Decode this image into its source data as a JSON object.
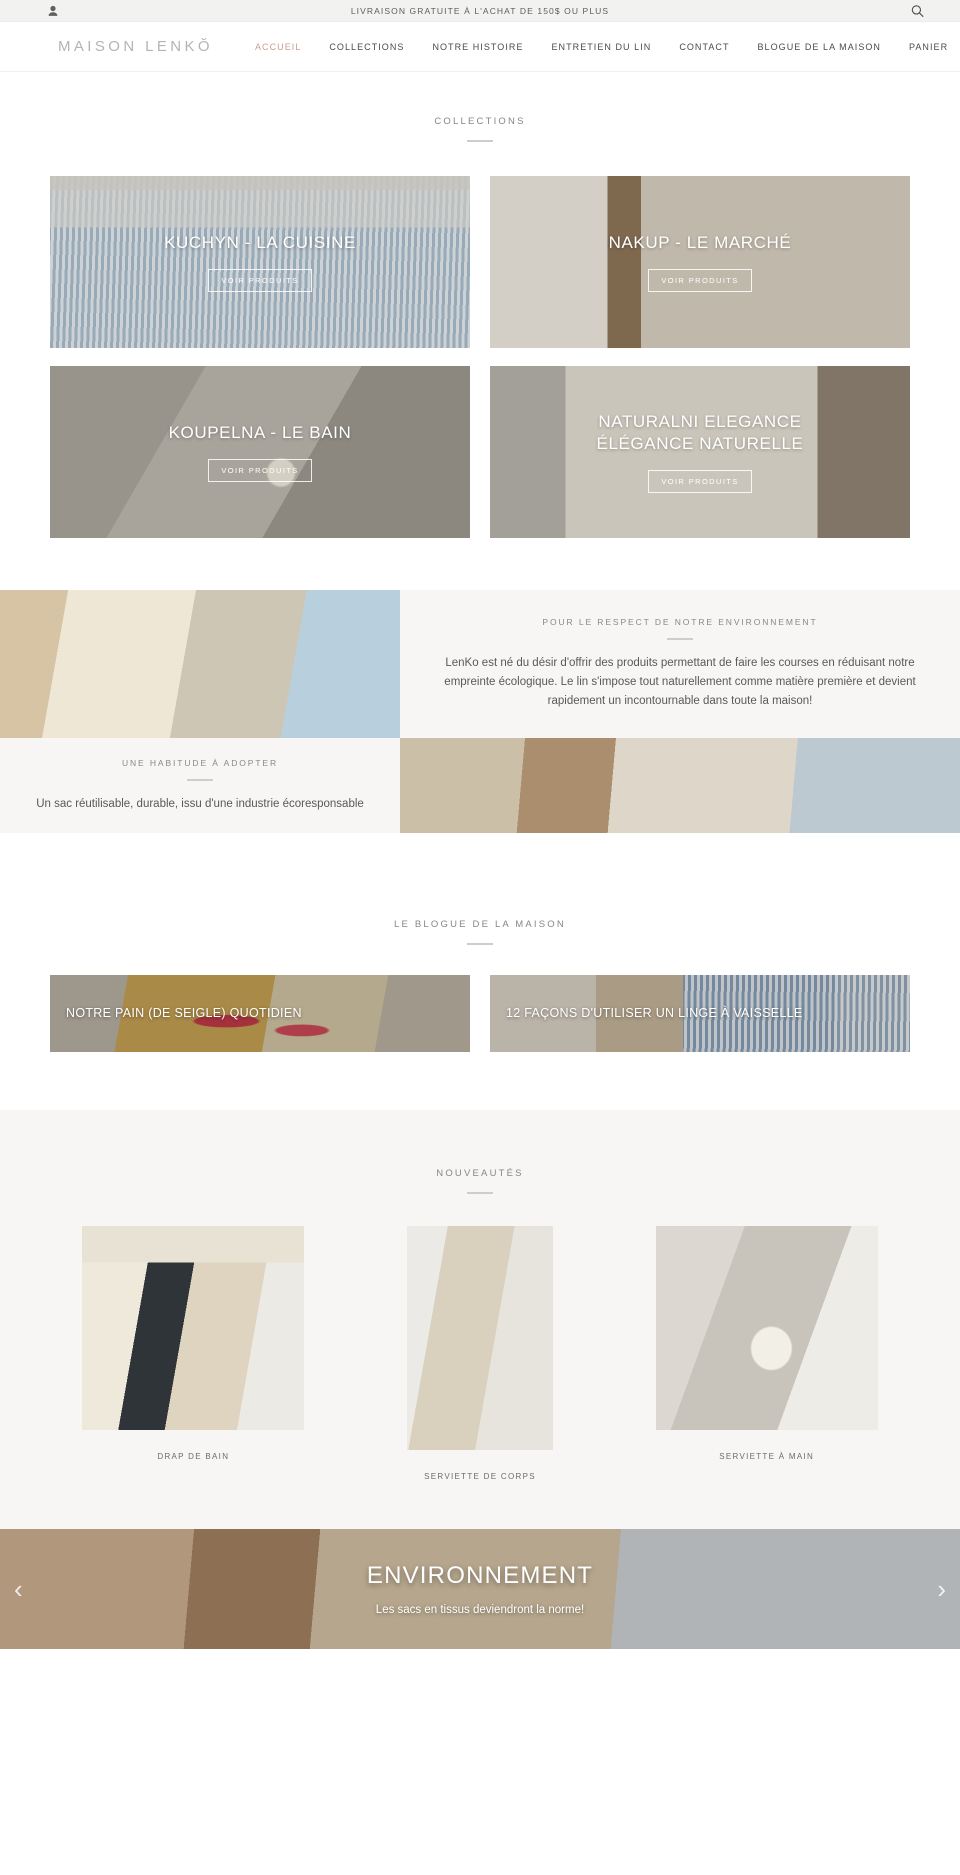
{
  "announcement": {
    "text": "LIVRAISON GRATUITE À L'ACHAT DE 150$ OU PLUS",
    "account_icon": "user-icon",
    "search_icon": "search-icon"
  },
  "header": {
    "logo": "MAISON LENKŎ",
    "nav": [
      {
        "label": "ACCUEIL",
        "active": true
      },
      {
        "label": "COLLECTIONS",
        "active": false
      },
      {
        "label": "NOTRE HISTOIRE",
        "active": false
      },
      {
        "label": "ENTRETIEN DU LIN",
        "active": false
      },
      {
        "label": "CONTACT",
        "active": false
      },
      {
        "label": "BLOGUE DE LA MAISON",
        "active": false
      },
      {
        "label": "PANIER",
        "active": false
      }
    ]
  },
  "collections": {
    "heading": "COLLECTIONS",
    "cards": [
      {
        "title": "KUCHYN - LA CUISINE",
        "button": "VOIR PRODUITS"
      },
      {
        "title": "NAKUP - LE MARCHÉ",
        "button": "VOIR PRODUITS"
      },
      {
        "title": "KOUPELNA - LE BAIN",
        "button": "VOIR PRODUITS"
      },
      {
        "title": "NATURALNI ELEGANCE\nÉLÉGANCE NATURELLE",
        "title_line1": "NATURALNI ELEGANCE",
        "title_line2": "ÉLÉGANCE NATURELLE",
        "button": "VOIR PRODUITS"
      }
    ]
  },
  "eco": {
    "block1": {
      "heading": "POUR LE RESPECT DE NOTRE ENVIRONNEMENT",
      "body": "LenKo est né du désir d'offrir des produits permettant de faire les courses en réduisant notre empreinte écologique. Le lin s'impose tout naturellement comme matière première et devient rapidement un incontournable dans toute la maison!"
    },
    "block2": {
      "heading": "UNE HABITUDE À ADOPTER",
      "body": "Un sac réutilisable, durable, issu d'une industrie écoresponsable"
    }
  },
  "blog": {
    "heading": "LE BLOGUE DE LA MAISON",
    "posts": [
      {
        "title": "NOTRE PAIN (DE SEIGLE) QUOTIDIEN"
      },
      {
        "title": "12 FAÇONS D'UTILISER UN LINGE À VAISSELLE"
      }
    ]
  },
  "news": {
    "heading": "NOUVEAUTÉS",
    "products": [
      {
        "label": "DRAP DE BAIN"
      },
      {
        "label": "SERVIETTE DE CORPS"
      },
      {
        "label": "SERVIETTE À MAIN"
      }
    ]
  },
  "hero": {
    "title": "ENVIRONNEMENT",
    "subtitle": "Les sacs en tissus deviendront la norme!",
    "prev_icon": "chevron-left-icon",
    "next_icon": "chevron-right-icon"
  },
  "colors": {
    "accent": "#c7a093",
    "muted_bg": "#f7f6f5",
    "announce_bg": "#f2f2f1",
    "text": "#555555"
  }
}
